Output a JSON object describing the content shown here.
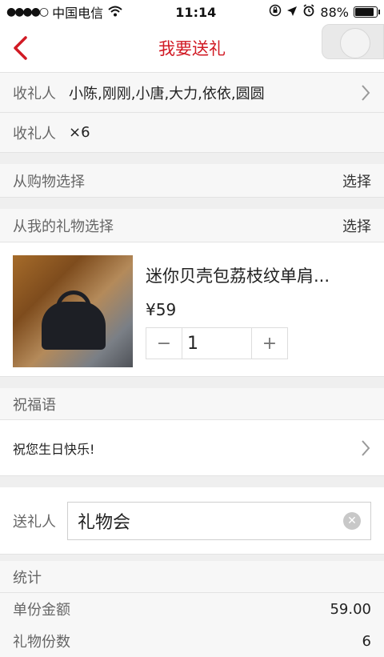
{
  "status_bar": {
    "signal_dots": "●●●●○",
    "carrier": "中国电信",
    "time": "11:14",
    "battery_percent": "88%",
    "battery_level": 0.88
  },
  "nav": {
    "title": "我要送礼",
    "back_icon": "chevron-left-icon"
  },
  "recipients": {
    "label": "收礼人",
    "names": "小陈,刚刚,小唐,大力,依依,圆圆",
    "count_label": "收礼人",
    "count": "×6"
  },
  "sources": [
    {
      "label": "从购物选择",
      "action": "选择"
    },
    {
      "label": "从我的礼物选择",
      "action": "选择"
    }
  ],
  "product": {
    "name": "迷你贝壳包荔枝纹单肩...",
    "price": "¥59",
    "quantity": "1",
    "minus": "−",
    "plus": "+"
  },
  "blessing": {
    "header": "祝福语",
    "text": "祝您生日快乐!"
  },
  "sender": {
    "label": "送礼人",
    "value": "礼物会"
  },
  "stats": {
    "header": "统计",
    "unit_amount_label": "单份金额",
    "unit_amount": "59.00",
    "gift_count_label": "礼物份数",
    "gift_count": "6"
  },
  "colors": {
    "accent": "#d11a24"
  }
}
